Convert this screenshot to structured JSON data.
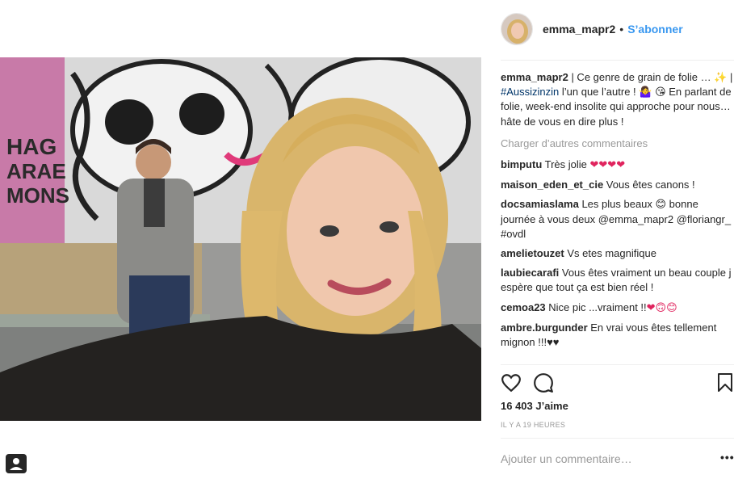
{
  "colors": {
    "link": "#3897f0",
    "hashtag": "#003569",
    "muted": "#999999",
    "heart": "#e0245e"
  },
  "post": {
    "image_alt": "photo",
    "user_tag_icon": "user-tag-icon"
  },
  "header": {
    "username": "emma_mapr2",
    "separator": "•",
    "follow_label": "S’abonner",
    "avatar_icon": "avatar"
  },
  "caption": {
    "username": "emma_mapr2",
    "text_before": " | Ce genre de grain de folie … ✨ | ",
    "hashtag": "#Aussizinzin",
    "text_after": " l’un que l’autre ! 🤷‍♀️ 😘 En parlant de folie, week-end insolite qui approche pour nous… hâte de vous en dire plus !"
  },
  "load_more_label": "Charger d’autres commentaires",
  "comments": [
    {
      "username": "bimputu",
      "text": " Très jolie ",
      "emoji": "❤❤❤❤"
    },
    {
      "username": "maison_eden_et_cie",
      "text": " Vous êtes canons !",
      "emoji": ""
    },
    {
      "username": "docsamiaslama",
      "text": " Les plus beaux 😊 bonne journée à vous deux @emma_mapr2 @floriangr_ #ovdl",
      "emoji": ""
    },
    {
      "username": "amelietouzet",
      "text": " Vs etes magnifique",
      "emoji": ""
    },
    {
      "username": "laubiecarafi",
      "text": " Vous êtes vraiment un beau couple j espère que tout ça est bien réel !",
      "emoji": ""
    },
    {
      "username": "cemoa23",
      "text": " Nice pic ...vraiment !!",
      "emoji": "❤🙃😊"
    },
    {
      "username": "ambre.burgunder",
      "text": " En vrai vous êtes tellement mignon !!!♥♥",
      "emoji": ""
    }
  ],
  "actions": {
    "like_icon": "heart-icon",
    "comment_icon": "comment-icon",
    "save_icon": "bookmark-icon"
  },
  "likes_label": "16 403 J’aime",
  "timestamp": "IL Y A 19 HEURES",
  "add_comment_placeholder": "Ajouter un commentaire…",
  "more_options_label": "•••"
}
